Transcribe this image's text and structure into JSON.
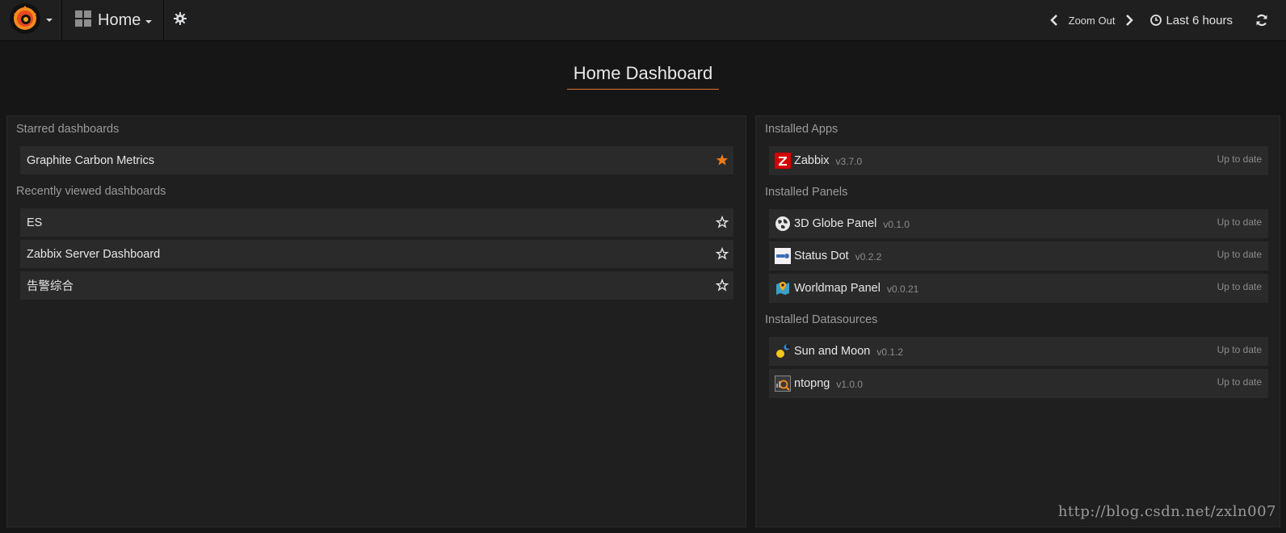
{
  "navbar": {
    "logo_icon": "grafana-logo-icon",
    "home_label": "Home",
    "zoom_label": "Zoom Out",
    "time_label": "Last 6 hours"
  },
  "page_title": "Home Dashboard",
  "left": {
    "starred_title": "Starred dashboards",
    "starred": [
      {
        "name": "Graphite Carbon Metrics",
        "starred": true
      }
    ],
    "recent_title": "Recently viewed dashboards",
    "recent": [
      {
        "name": "ES",
        "starred": false
      },
      {
        "name": "Zabbix Server Dashboard",
        "starred": false
      },
      {
        "name": "告警综合",
        "starred": false
      }
    ]
  },
  "right": {
    "apps_title": "Installed Apps",
    "apps": [
      {
        "name": "Zabbix",
        "version": "v3.7.0",
        "status": "Up to date",
        "icon": "zabbix-icon"
      }
    ],
    "panels_title": "Installed Panels",
    "panels": [
      {
        "name": "3D Globe Panel",
        "version": "v0.1.0",
        "status": "Up to date",
        "icon": "globe-icon"
      },
      {
        "name": "Status Dot",
        "version": "v0.2.2",
        "status": "Up to date",
        "icon": "status-dot-icon"
      },
      {
        "name": "Worldmap Panel",
        "version": "v0.0.21",
        "status": "Up to date",
        "icon": "worldmap-icon"
      }
    ],
    "datasources_title": "Installed Datasources",
    "datasources": [
      {
        "name": "Sun and Moon",
        "version": "v0.1.2",
        "status": "Up to date",
        "icon": "sun-moon-icon"
      },
      {
        "name": "ntopng",
        "version": "v1.0.0",
        "status": "Up to date",
        "icon": "ntopng-icon"
      }
    ]
  },
  "watermark": "http://blog.csdn.net/zxln007",
  "colors": {
    "accent": "#eb7b18",
    "background": "#161616",
    "panel": "#1f1f20",
    "row": "#2a2a2b"
  }
}
